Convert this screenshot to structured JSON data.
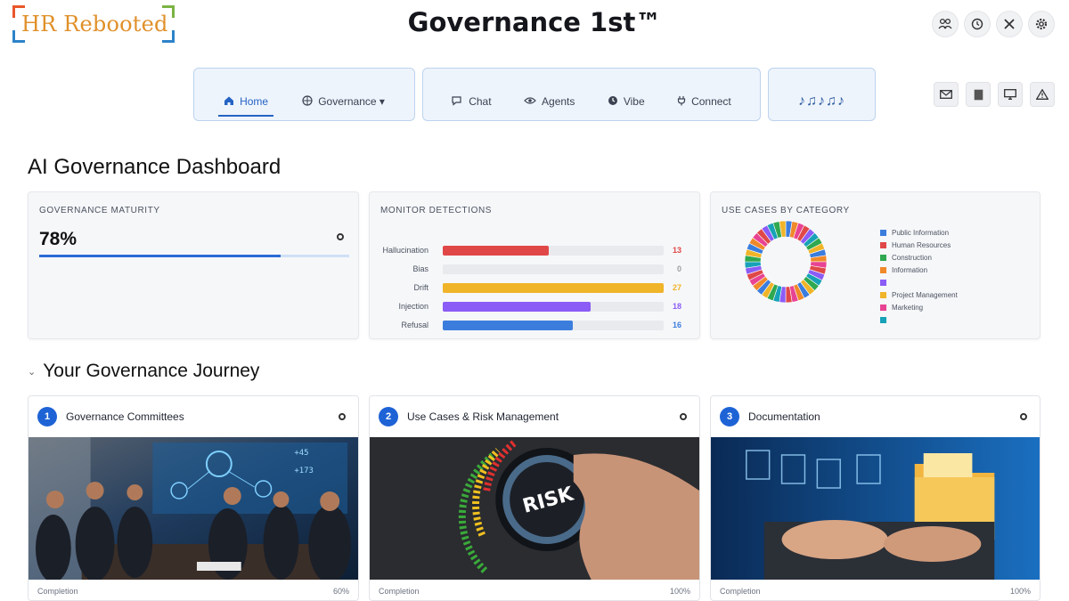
{
  "header": {
    "logo_text": "HR Rebooted",
    "app_title": "Governance 1st™",
    "icons": [
      "people-icon",
      "clock-icon",
      "tools-icon",
      "gear-icon"
    ]
  },
  "nav": {
    "group1": {
      "items": [
        {
          "label": "Home",
          "icon": "home-icon",
          "active": true
        },
        {
          "label": "Governance ▾",
          "icon": "globe-icon",
          "active": false
        }
      ]
    },
    "group2": {
      "items": [
        {
          "label": "Chat",
          "icon": "chat-icon"
        },
        {
          "label": "Agents",
          "icon": "eye-icon"
        },
        {
          "label": "Vibe",
          "icon": "timer-icon"
        },
        {
          "label": "Connect",
          "icon": "plug-icon"
        }
      ]
    },
    "group3": {
      "symbol": "♪♫♪♫♪"
    },
    "side_icons": [
      "mail-icon",
      "document-icon",
      "monitor-icon",
      "warning-icon"
    ]
  },
  "dashboard": {
    "title": "AI Governance Dashboard",
    "maturity": {
      "heading": "Governance Maturity",
      "value": "78%",
      "progress": 0.78
    },
    "monitor": {
      "heading": "Monitor Detections",
      "rows": [
        {
          "label": "Hallucination",
          "count": "13",
          "fraction": 0.48,
          "color": "#e04848"
        },
        {
          "label": "Bias",
          "count": "0",
          "fraction": 0.0,
          "color": "#a0a0a0"
        },
        {
          "label": "Drift",
          "count": "27",
          "fraction": 1.0,
          "color": "#f0b429"
        },
        {
          "label": "Injection",
          "count": "18",
          "fraction": 0.67,
          "color": "#8b5cf6"
        },
        {
          "label": "Refusal",
          "count": "16",
          "fraction": 0.59,
          "color": "#3b7ddd"
        }
      ]
    },
    "use_cases": {
      "heading": "Use Cases by Category",
      "legend": [
        {
          "label": "Public Information",
          "color": "#3b7ddd"
        },
        {
          "label": "Human Resources",
          "color": "#e04848"
        },
        {
          "label": "Construction",
          "color": "#2fa84f"
        },
        {
          "label": "Information",
          "color": "#f0892a"
        },
        {
          "label": "",
          "color": "#8b5cf6"
        },
        {
          "label": "Project Management",
          "color": "#f0b429"
        },
        {
          "label": "Marketing",
          "color": "#e84393"
        },
        {
          "label": "",
          "color": "#17a2b8"
        }
      ]
    }
  },
  "journey": {
    "title": "Your Governance Journey",
    "cards": [
      {
        "step": "1",
        "title": "Governance Committees",
        "foot_label": "Completion",
        "foot_value": "60%",
        "image_icon": "meeting-image"
      },
      {
        "step": "2",
        "title": "Use Cases & Risk Management",
        "foot_label": "Completion",
        "foot_value": "100%",
        "image_icon": "risk-dial-image"
      },
      {
        "step": "3",
        "title": "Documentation",
        "foot_label": "Completion",
        "foot_value": "100%",
        "image_icon": "documents-image"
      }
    ]
  }
}
